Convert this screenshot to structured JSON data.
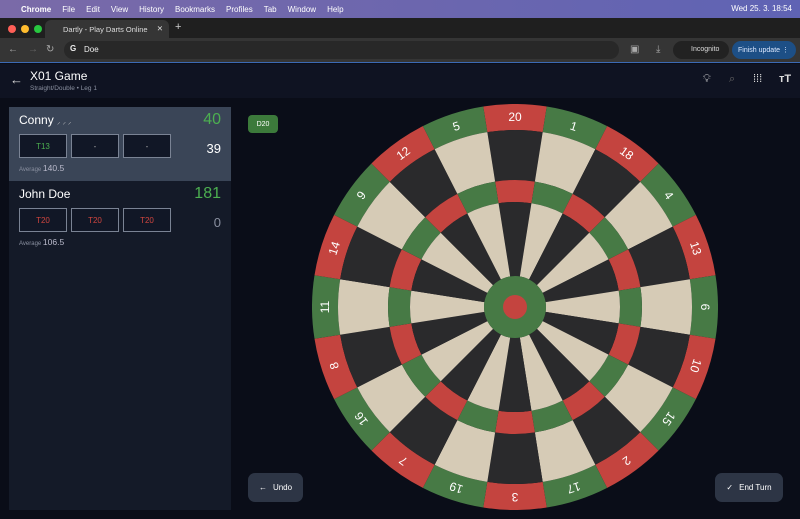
{
  "menubar": {
    "app": "Chrome",
    "items": [
      "File",
      "Edit",
      "View",
      "History",
      "Bookmarks",
      "Profiles",
      "Tab",
      "Window",
      "Help"
    ],
    "clock": "Wed 25. 3.  18:54"
  },
  "browser": {
    "tab_title": "Dartly - Play Darts Online",
    "address": "Doe",
    "incognito": "Incognito",
    "finish_update": "Finish update"
  },
  "header": {
    "title": "X01 Game",
    "subtitle": "Straight/Double • Leg 1"
  },
  "players": [
    {
      "name": "Conny",
      "score": "40",
      "darts": [
        "T13",
        "-",
        "-"
      ],
      "remaining": "39",
      "avg_label": "Average",
      "avg": "140.5",
      "active": true
    },
    {
      "name": "John Doe",
      "score": "181",
      "darts": [
        "T20",
        "T20",
        "T20"
      ],
      "remaining": "0",
      "avg_label": "Average",
      "avg": "106.5",
      "active": false
    }
  ],
  "checkout_hint": "D20",
  "buttons": {
    "undo": "Undo",
    "end_turn": "End Turn"
  },
  "board": {
    "numbers": [
      20,
      1,
      18,
      4,
      13,
      6,
      10,
      15,
      2,
      17,
      3,
      19,
      7,
      16,
      8,
      11,
      14,
      9,
      12,
      5
    ],
    "colors": {
      "red": "#c4443f",
      "green": "#477a45",
      "beige": "#d6cbb6",
      "black": "#2a2a2c"
    }
  }
}
